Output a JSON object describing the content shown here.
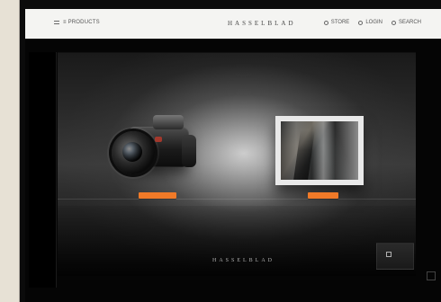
{
  "header": {
    "left_text": "≡ PRODUCTS",
    "brand": "HASSELBLAD",
    "actions": [
      "STORE",
      "LOGIN",
      "SEARCH"
    ]
  },
  "subnav": [
    "",
    "",
    "",
    "",
    "",
    "",
    "",
    "",
    ""
  ],
  "breadcrumb": "",
  "products": [
    {
      "name": "",
      "cta": ""
    },
    {
      "name": "",
      "cta": ""
    }
  ],
  "footer": {
    "brand": "HASSELBLAD"
  }
}
